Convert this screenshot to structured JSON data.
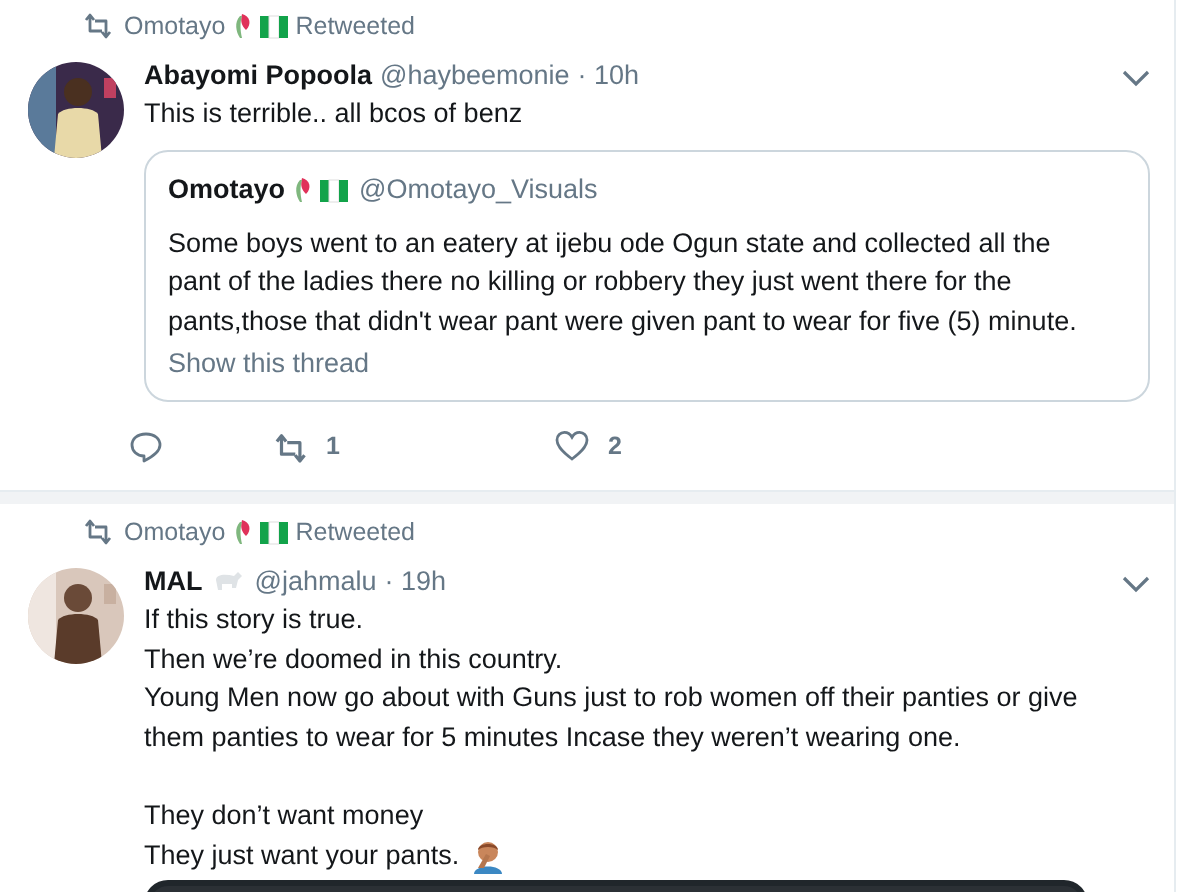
{
  "tweets": [
    {
      "retweeted_by": {
        "name": "Omotayo",
        "label": "Retweeted"
      },
      "author": {
        "name": "Abayomi Popoola",
        "handle": "@haybeemonie",
        "time": "· 10h"
      },
      "paragraphs": [
        [
          {
            "text": "This is terrible.. all bcos of benz"
          }
        ]
      ],
      "quote": {
        "name": "Omotayo",
        "handle": "@Omotayo_Visuals",
        "text": "Some boys went to an eatery at ijebu ode Ogun state and collected all the pant of the ladies there no killing or robbery they just went there for the pants,those that didn't wear pant were given pant to wear for five (5) minute.",
        "link": "Show this thread"
      },
      "actions": {
        "retweets": "1",
        "likes": "2"
      }
    },
    {
      "retweeted_by": {
        "name": "Omotayo",
        "label": "Retweeted"
      },
      "author": {
        "name": "MAL",
        "badge_icon": true,
        "handle": "@jahmalu",
        "time": "· 19h"
      },
      "paragraphs": [
        [
          {
            "text": "If this story is true."
          },
          {
            "text": "Then we’re doomed in this country."
          },
          {
            "text": "Young Men now go about with Guns just to rob women off their panties or give them panties to wear for 5 minutes Incase they weren’t wearing one."
          }
        ],
        [
          {
            "text": "They don’t want money"
          },
          {
            "text": "They just want your pants.",
            "icon_after": true
          }
        ]
      ],
      "media": true
    }
  ]
}
